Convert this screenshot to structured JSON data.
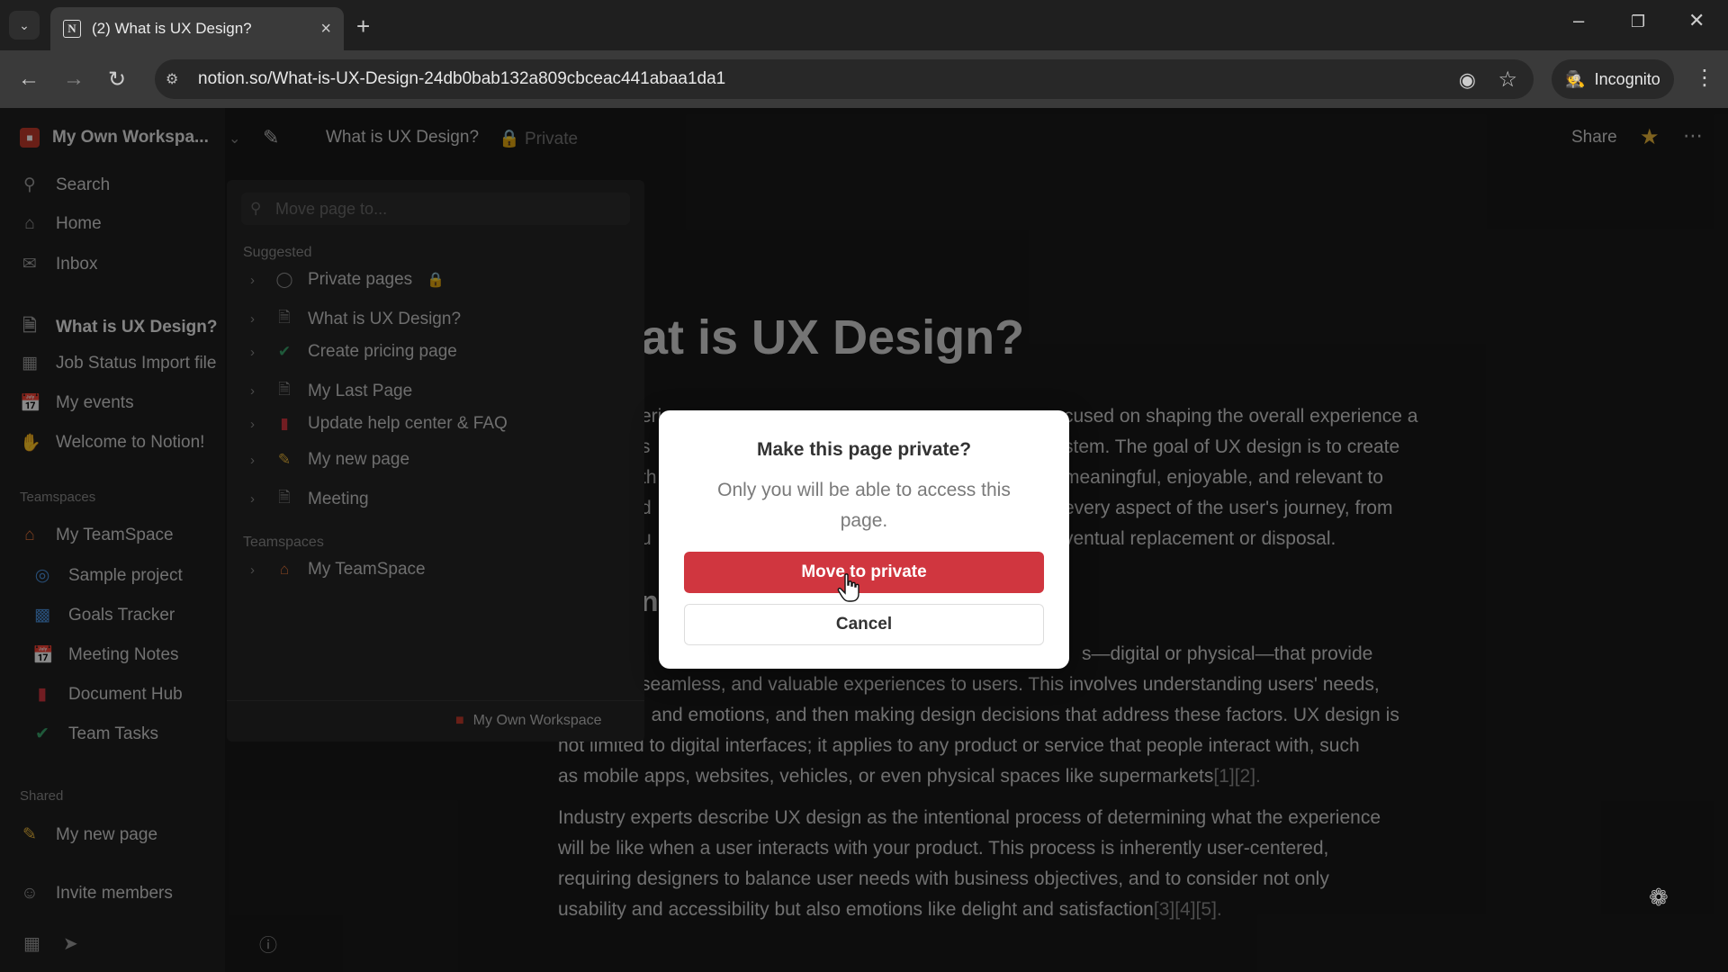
{
  "browser": {
    "tab_title": "(2) What is UX Design?",
    "favicon_letter": "N",
    "url": "notion.so/What-is-UX-Design-24db0bab132a809cbceac441abaa1da1",
    "incognito_label": "Incognito"
  },
  "sidebar": {
    "workspace_name": "My Own Workspa...",
    "items": [
      {
        "label": "Search",
        "icon": "search-icon"
      },
      {
        "label": "Home",
        "icon": "home-icon"
      },
      {
        "label": "Inbox",
        "icon": "inbox-icon"
      }
    ],
    "pages": [
      {
        "label": "What is UX Design?",
        "icon": "page-icon"
      },
      {
        "label": "Job Status Import file",
        "icon": "table-icon"
      },
      {
        "label": "My events",
        "icon": "calendar-icon"
      },
      {
        "label": "Welcome to Notion!",
        "icon": "wave-icon"
      }
    ],
    "teamspaces_label": "Teamspaces",
    "teamspace_name": "My TeamSpace",
    "teamspace_items": [
      {
        "label": "Sample project",
        "icon": "target-icon"
      },
      {
        "label": "Goals Tracker",
        "icon": "chart-icon"
      },
      {
        "label": "Meeting Notes",
        "icon": "calendar-icon"
      },
      {
        "label": "Document Hub",
        "icon": "book-icon"
      },
      {
        "label": "Team Tasks",
        "icon": "check-icon"
      }
    ],
    "shared_label": "Shared",
    "shared_item": "My new page",
    "invite_label": "Invite members"
  },
  "topbar": {
    "breadcrumb": "What is UX Design?",
    "privacy": "Private",
    "share_label": "Share"
  },
  "move_panel": {
    "search_placeholder": "Move page to...",
    "suggested_label": "Suggested",
    "suggested": [
      {
        "label": "Private pages",
        "icon": "private-pages-icon"
      },
      {
        "label": "What is UX Design?",
        "icon": "page-icon"
      },
      {
        "label": "Create pricing page",
        "icon": "check-icon"
      },
      {
        "label": "My Last Page",
        "icon": "page-icon"
      },
      {
        "label": "Update help center & FAQ",
        "icon": "book-icon"
      },
      {
        "label": "My new page",
        "icon": "pencil-icon"
      },
      {
        "label": "Meeting",
        "icon": "page-icon"
      }
    ],
    "teamspaces_label": "Teamspaces",
    "teamspace_item": "My TeamSpace",
    "footer_workspace": "My Own Workspace"
  },
  "page": {
    "title": "at is UX Design?",
    "para1": [
      "cused on shaping the overall experience a",
      "stem. The goal of UX design is to create",
      "meaningful, enjoyable, and relevant to",
      "every aspect of the user's journey, from",
      "ventual replacement or disposal."
    ],
    "para1_left": [
      "eri",
      "s",
      "th",
      "d",
      "u"
    ],
    "heading_fragment": "n",
    "para2_line1": "s—digital or physical—that provide",
    "para2_line2": "seamless, and valuable experiences to users. This involves understanding users' needs,",
    "para2_line3": ", and emotions, and then making design decisions that address these factors. UX design is",
    "para2_line4": "not limited to digital interfaces; it applies to any product or service that people interact with, such",
    "para2_line5": "as mobile apps, websites, vehicles, or even physical spaces like supermarkets",
    "para2_ref": "[1][2].",
    "para3_line1": "Industry experts describe UX design as the intentional process of determining what the experience",
    "para3_line2": "will be like when a user interacts with your product. This process is inherently user-centered,",
    "para3_line3": "requiring designers to balance user needs with business objectives, and to consider not only",
    "para3_line4": "usability and accessibility but also emotions like delight and satisfaction",
    "para3_ref": "[3][4][5]."
  },
  "dialog": {
    "title": "Make this page private?",
    "description": "Only you will be able to access this page.",
    "primary_label": "Move to private",
    "secondary_label": "Cancel"
  }
}
